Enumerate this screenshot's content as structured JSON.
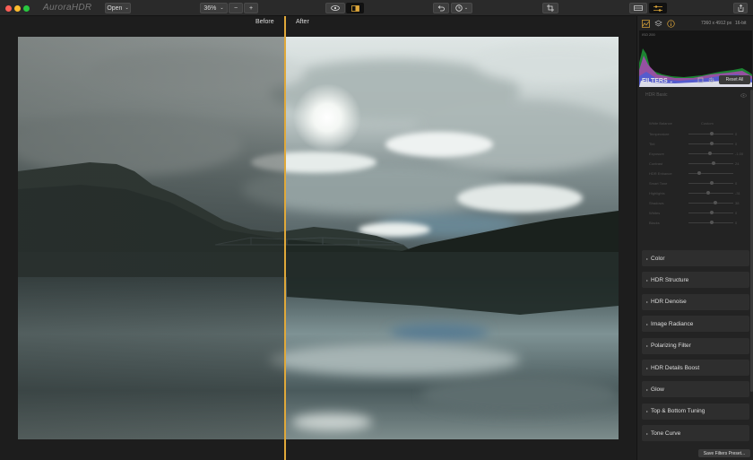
{
  "app": {
    "logo_text": "AuroraHDR"
  },
  "toolbar": {
    "open_label": "Open",
    "zoom_value": "36%",
    "zoom_minus": "−",
    "zoom_plus": "+"
  },
  "canvas": {
    "before_label": "Before",
    "after_label": "After"
  },
  "info": {
    "dimensions": "7360 x 4912 px",
    "bit_depth": "16-bit",
    "histogram_label": "ISO 200"
  },
  "filters": {
    "title": "FILTERS",
    "reset_label": "Reset All",
    "hdr_basic": {
      "title": "HDR Basic",
      "white_balance_label": "White Balance",
      "white_balance_value": "Custom",
      "rows": [
        {
          "label": "Temperature",
          "value": "0"
        },
        {
          "label": "Tint",
          "value": "0"
        },
        {
          "label": "Exposure",
          "value": "-1.00"
        },
        {
          "label": "Contrast",
          "value": "24"
        },
        {
          "label": "HDR Enhance",
          "value": ""
        },
        {
          "label": "Smart Tone",
          "value": "0"
        },
        {
          "label": "Highlights",
          "value": "-31"
        },
        {
          "label": "Shadows",
          "value": "38"
        },
        {
          "label": "Whites",
          "value": "0"
        },
        {
          "label": "Blacks",
          "value": "0"
        }
      ]
    },
    "sections": [
      "Color",
      "HDR Structure",
      "HDR Denoise",
      "Image Radiance",
      "Polarizing Filter",
      "HDR Details Boost",
      "Glow",
      "Top & Bottom Tuning",
      "Tone Curve"
    ],
    "save_preset_label": "Save Filters Preset..."
  },
  "colors": {
    "accent": "#e0a83a",
    "close": "#fc5f57",
    "minimize": "#fdbc2e",
    "maximize": "#28c83f"
  }
}
